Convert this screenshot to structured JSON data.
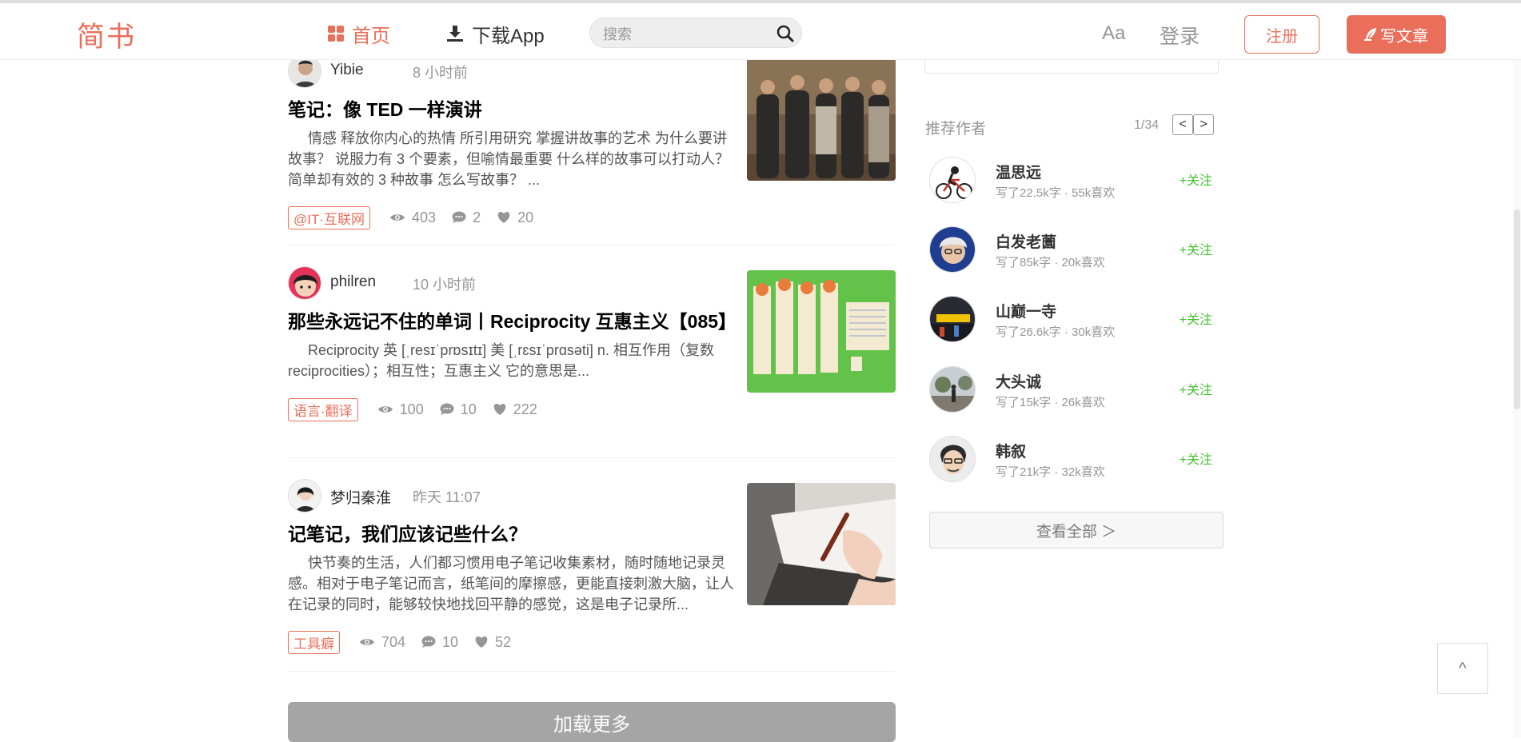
{
  "header": {
    "logo": "简书",
    "nav": {
      "home": "首页",
      "app": "下载App"
    },
    "search": {
      "placeholder": "搜索"
    },
    "aa": "Aa",
    "login": "登录",
    "register": "注册",
    "write": "写文章"
  },
  "articles": [
    {
      "author": "Yibie",
      "time": "8 小时前",
      "title": "笔记：像 TED 一样演讲",
      "abstract": "情感 释放你内心的热情 所引用研究 掌握讲故事的艺术 为什么要讲故事？ 说服力有 3 个要素，但喻情最重要 什么样的故事可以打动人？ 简单却有效的 3 种故事 怎么写故事？ ...",
      "tag": "@IT·互联网",
      "views": "403",
      "comments": "2",
      "likes": "20"
    },
    {
      "author": "philren",
      "time": "10 小时前",
      "title": "那些永远记不住的单词丨Reciprocity 互惠主义【085】",
      "abstract": "Reciprocity 英 [ˌresɪˈprɒsɪtɪ] 美 [ˌrɛsɪˈprɑsəti] n. 相互作用（复数 reciprocities）；相互性；互惠主义 它的意思是...",
      "tag": "语言·翻译",
      "views": "100",
      "comments": "10",
      "likes": "222"
    },
    {
      "author": "梦归秦淮",
      "time": "昨天 11:07",
      "title": "记笔记，我们应该记些什么？",
      "abstract": "快节奏的生活，人们都习惯用电子笔记收集素材，随时随地记录灵感。相对于电子笔记而言，纸笔间的摩擦感，更能直接刺激大脑，让人在记录的同时，能够较快地找回平静的感觉，这是电子记录所...",
      "tag": "工具癖",
      "views": "704",
      "comments": "10",
      "likes": "52"
    }
  ],
  "load_more": "加载更多",
  "sidebar": {
    "title": "推荐作者",
    "page": "1/34",
    "prev": "<",
    "next": ">",
    "authors": [
      {
        "name": "温思远",
        "desc": "写了22.5k字 · 55k喜欢",
        "follow": "+关注"
      },
      {
        "name": "白发老薗",
        "desc": "写了85k字 · 20k喜欢",
        "follow": "+关注"
      },
      {
        "name": "山巅一寺",
        "desc": "写了26.6k字 · 30k喜欢",
        "follow": "+关注"
      },
      {
        "name": "大头诚",
        "desc": "写了15k字 · 26k喜欢",
        "follow": "+关注"
      },
      {
        "name": "韩叙",
        "desc": "写了21k字 · 32k喜欢",
        "follow": "+关注"
      }
    ],
    "see_all": "查看全部 ＞"
  },
  "back_to_top": "^",
  "colors": {
    "accent": "#ea6f5a",
    "follow": "#42c02e",
    "muted": "#969696"
  },
  "icons": [
    "home-icon",
    "download-icon",
    "search-icon",
    "feather-icon",
    "eye-icon",
    "comment-icon",
    "heart-icon"
  ]
}
